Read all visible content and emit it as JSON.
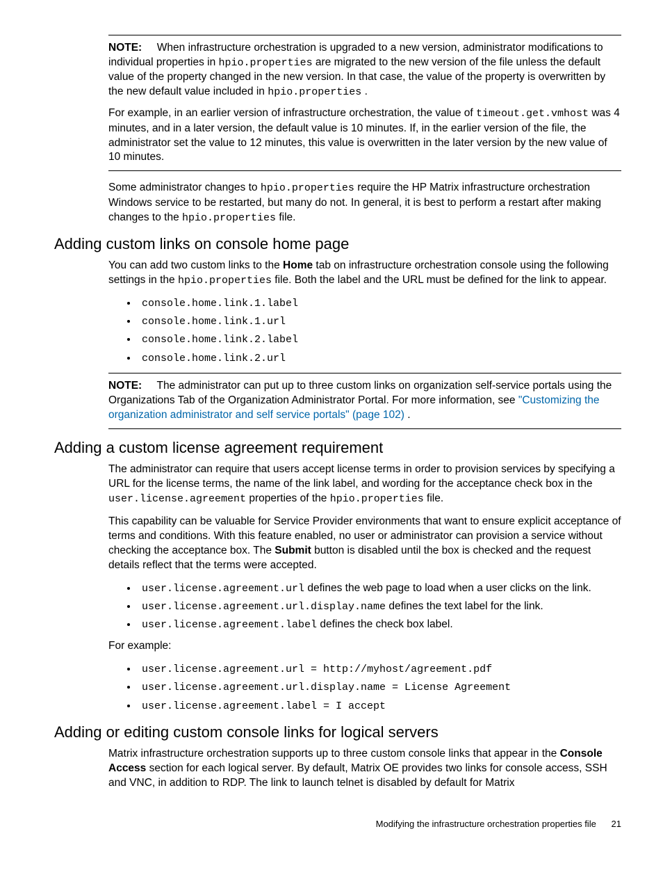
{
  "note1": {
    "lead": "NOTE:",
    "t1": "When infrastructure orchestration is upgraded to a new version, administrator modifications to individual properties in ",
    "c1": "hpio.properties",
    "t2": " are migrated to the new version of the file unless the default value of the property changed in the new version. In that case, the value of the property is overwritten by the new default value included in ",
    "c2": "hpio.properties",
    "t3": ".",
    "p2a": "For example, in an earlier version of infrastructure orchestration, the value of ",
    "p2c": "timeout.get.vmhost",
    "p2b": " was 4 minutes, and in a later version, the default value is 10 minutes. If, in the earlier version of the file, the administrator set the value to 12 minutes, this value is overwritten in the later version by the new value of 10 minutes."
  },
  "para_after_note1": {
    "t1": "Some administrator changes to ",
    "c1": "hpio.properties",
    "t2": " require the HP Matrix infrastructure orchestration Windows service to be restarted, but many do not. In general, it is best to perform a restart after making changes to the ",
    "c2": "hpio.properties",
    "t3": " file."
  },
  "sec1": {
    "heading": "Adding custom links on console home page",
    "p1a": "You can add two custom links to the ",
    "p1b": "Home",
    "p1c": " tab on infrastructure orchestration console using the following settings in the ",
    "p1d": "hpio.properties",
    "p1e": " file. Both the label and the URL must be defined for the link to appear.",
    "items": [
      "console.home.link.1.label",
      "console.home.link.1.url",
      "console.home.link.2.label",
      "console.home.link.2.url"
    ]
  },
  "note2": {
    "lead": "NOTE:",
    "t1": "The administrator can put up to three custom links on organization self-service portals using the Organizations Tab of the Organization Administrator Portal. For more information, see ",
    "link": "\"Customizing the organization administrator and self service portals\" (page 102)",
    "t2": "."
  },
  "sec2": {
    "heading": "Adding a custom license agreement requirement",
    "p1a": "The administrator can require that users accept license terms in order to provision services by specifying a URL for the license terms, the name of the link label, and wording for the acceptance check box in the ",
    "p1c1": "user.license.agreement",
    "p1b": " properties of the ",
    "p1c2": "hpio.properties",
    "p1d": " file.",
    "p2a": "This capability can be valuable for Service Provider environments that want to ensure explicit acceptance of terms and conditions. With this feature enabled, no user or administrator can provision a service without checking the acceptance box. The ",
    "p2b": "Submit",
    "p2c": " button is disabled until the box is checked and the request details reflect that the terms were accepted.",
    "defs": [
      {
        "code": "user.license.agreement.url",
        "text": " defines the web page to load when a user clicks on the link."
      },
      {
        "code": "user.license.agreement.url.display.name",
        "text": " defines the text label for the link."
      },
      {
        "code": "user.license.agreement.label",
        "text": " defines the check box label."
      }
    ],
    "example_label": "For example:",
    "examples": [
      "user.license.agreement.url = http://myhost/agreement.pdf",
      "user.license.agreement.url.display.name = License Agreement",
      "user.license.agreement.label = I accept"
    ]
  },
  "sec3": {
    "heading": "Adding or editing custom console links for logical servers",
    "p1a": "Matrix infrastructure orchestration supports up to three custom console links that appear in the ",
    "p1b": "Console Access",
    "p1c": " section for each logical server. By default, Matrix OE provides two links for console access, SSH and VNC, in addition to RDP. The link to launch telnet is disabled by default for Matrix"
  },
  "footer": {
    "text": "Modifying the infrastructure orchestration properties file",
    "page": "21"
  }
}
